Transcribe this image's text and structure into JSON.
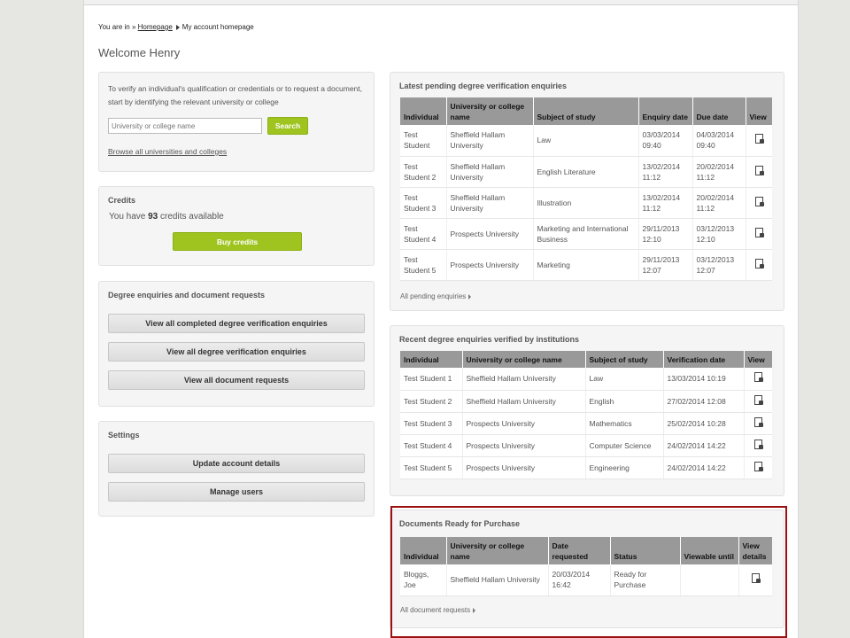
{
  "breadcrumb": {
    "prefix": "You are in »",
    "home": "Homepage",
    "current": "My account homepage"
  },
  "page_title": "Welcome Henry",
  "search": {
    "description": "To verify an individual's qualification or credentials or to request a document, start by identifying the relevant university or college",
    "placeholder": "University or college name",
    "button": "Search",
    "browse_link": "Browse all universities and colleges"
  },
  "credits": {
    "title": "Credits",
    "prefix": "You have",
    "count": "93",
    "suffix": "credits available",
    "button": "Buy credits"
  },
  "degree_section": {
    "title": "Degree enquiries and document requests",
    "buttons": [
      "View all completed degree verification enquiries",
      "View all degree verification enquiries",
      "View all document requests"
    ]
  },
  "settings": {
    "title": "Settings",
    "buttons": [
      "Update account details",
      "Manage users"
    ]
  },
  "pending": {
    "title": "Latest pending degree verification enquiries",
    "headers": [
      "Individual",
      "University or college name",
      "Subject of study",
      "Enquiry date",
      "Due date",
      "View"
    ],
    "rows": [
      [
        "Test Student",
        "Sheffield Hallam University",
        "Law",
        "03/03/2014 09:40",
        "04/03/2014 09:40"
      ],
      [
        "Test Student 2",
        "Sheffield Hallam University",
        "English Literature",
        "13/02/2014 11:12",
        "20/02/2014 11:12"
      ],
      [
        "Test Student 3",
        "Sheffield Hallam University",
        "Illustration",
        "13/02/2014 11:12",
        "20/02/2014 11:12"
      ],
      [
        "Test Student 4",
        "Prospects University",
        "Marketing and International Business",
        "29/11/2013 12:10",
        "03/12/2013 12:10"
      ],
      [
        "Test Student 5",
        "Prospects University",
        "Marketing",
        "29/11/2013 12:07",
        "03/12/2013 12:07"
      ]
    ],
    "more_link": "All pending enquiries"
  },
  "recent": {
    "title": "Recent degree enquiries verified by institutions",
    "headers": [
      "Individual",
      "University or college name",
      "Subject of study",
      "Verification date",
      "View"
    ],
    "rows": [
      [
        "Test Student 1",
        "Sheffield Hallam University",
        "Law",
        "13/03/2014 10:19"
      ],
      [
        "Test Student 2",
        "Sheffield Hallam University",
        "English",
        "27/02/2014 12:08"
      ],
      [
        "Test Student 3",
        "Prospects University",
        "Mathematics",
        "25/02/2014 10:28"
      ],
      [
        "Test Student 4",
        "Prospects University",
        "Computer Science",
        "24/02/2014 14:22"
      ],
      [
        "Test Student 5",
        "Prospects University",
        "Engineering",
        "24/02/2014 14:22"
      ]
    ]
  },
  "documents": {
    "title": "Documents Ready for Purchase",
    "headers": [
      "Individual",
      "University or college name",
      "Date requested",
      "Status",
      "Viewable until",
      "View details"
    ],
    "rows": [
      [
        "Bloggs, Joe",
        "Sheffield Hallam University",
        "20/03/2014 16:42",
        "Ready for Purchase",
        ""
      ]
    ],
    "more_link": "All document requests"
  },
  "icons": {
    "view": "document-view-icon",
    "breadcrumb_arrow": "triangle-right-icon",
    "more_arrow": "triangle-right-icon"
  },
  "colors": {
    "accent_green": "#9fc420",
    "header_grey": "#999999",
    "highlight_red": "#9b1010"
  }
}
